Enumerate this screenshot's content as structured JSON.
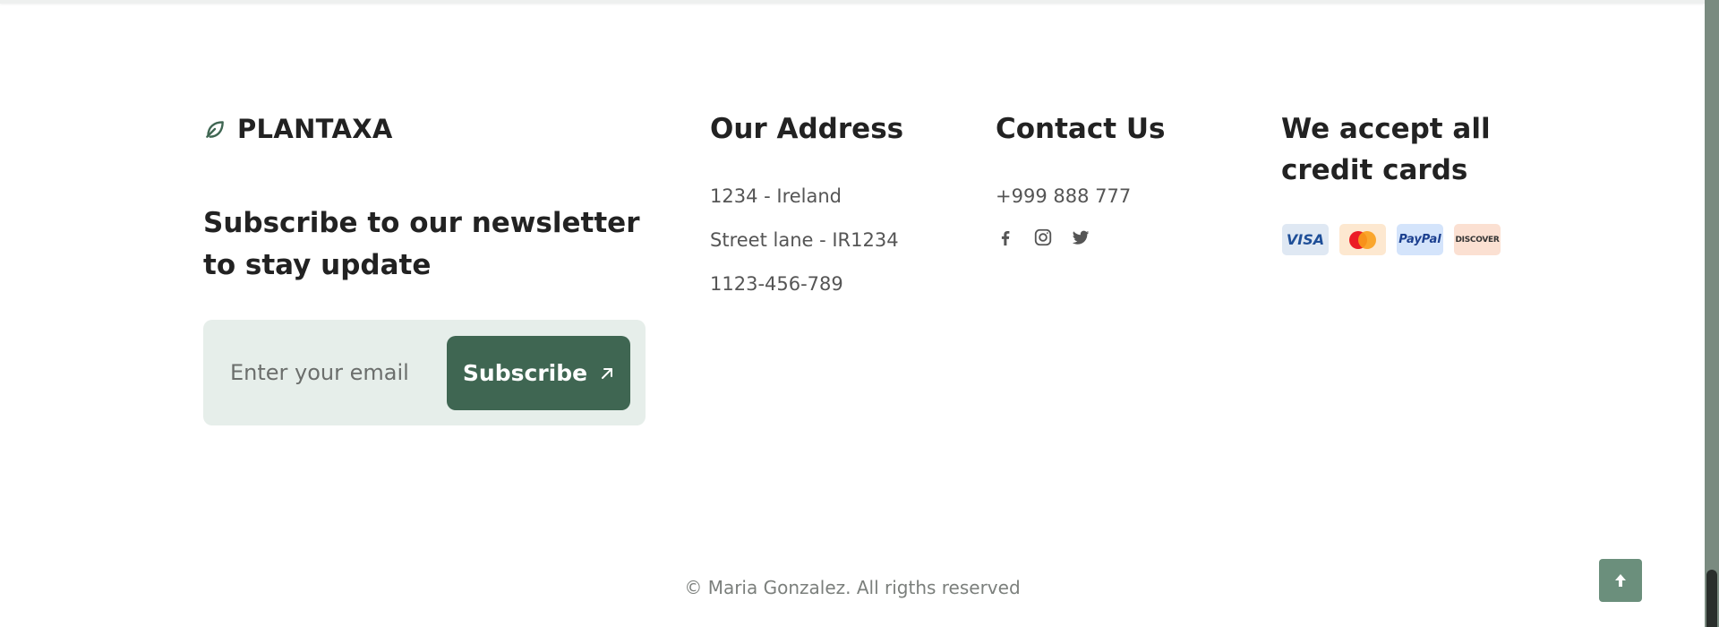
{
  "brand": {
    "name": "PLANTAXA",
    "icon": "leaf-icon",
    "accent_color": "#3f6652"
  },
  "newsletter": {
    "heading": "Subscribe to our newsletter to stay update",
    "email_placeholder": "Enter your email",
    "button_label": "Subscribe",
    "button_icon": "arrow-up-right-icon"
  },
  "address": {
    "heading": "Our Address",
    "lines": [
      "1234 - Ireland",
      "Street lane - IR1234",
      "1123-456-789"
    ]
  },
  "contact": {
    "heading": "Contact Us",
    "phone": "+999 888 777",
    "social": [
      "facebook-icon",
      "instagram-icon",
      "twitter-icon"
    ]
  },
  "payment": {
    "heading": "We accept all credit cards",
    "cards": [
      {
        "name": "visa-card",
        "label": "VISA"
      },
      {
        "name": "mastercard-card",
        "label": ""
      },
      {
        "name": "paypal-card",
        "label": "PayPal"
      },
      {
        "name": "discover-card",
        "label": "DISCOVER"
      }
    ]
  },
  "footer": {
    "copyright": "© Maria Gonzalez. All rigths reserved",
    "back_to_top_icon": "arrow-up-icon"
  }
}
